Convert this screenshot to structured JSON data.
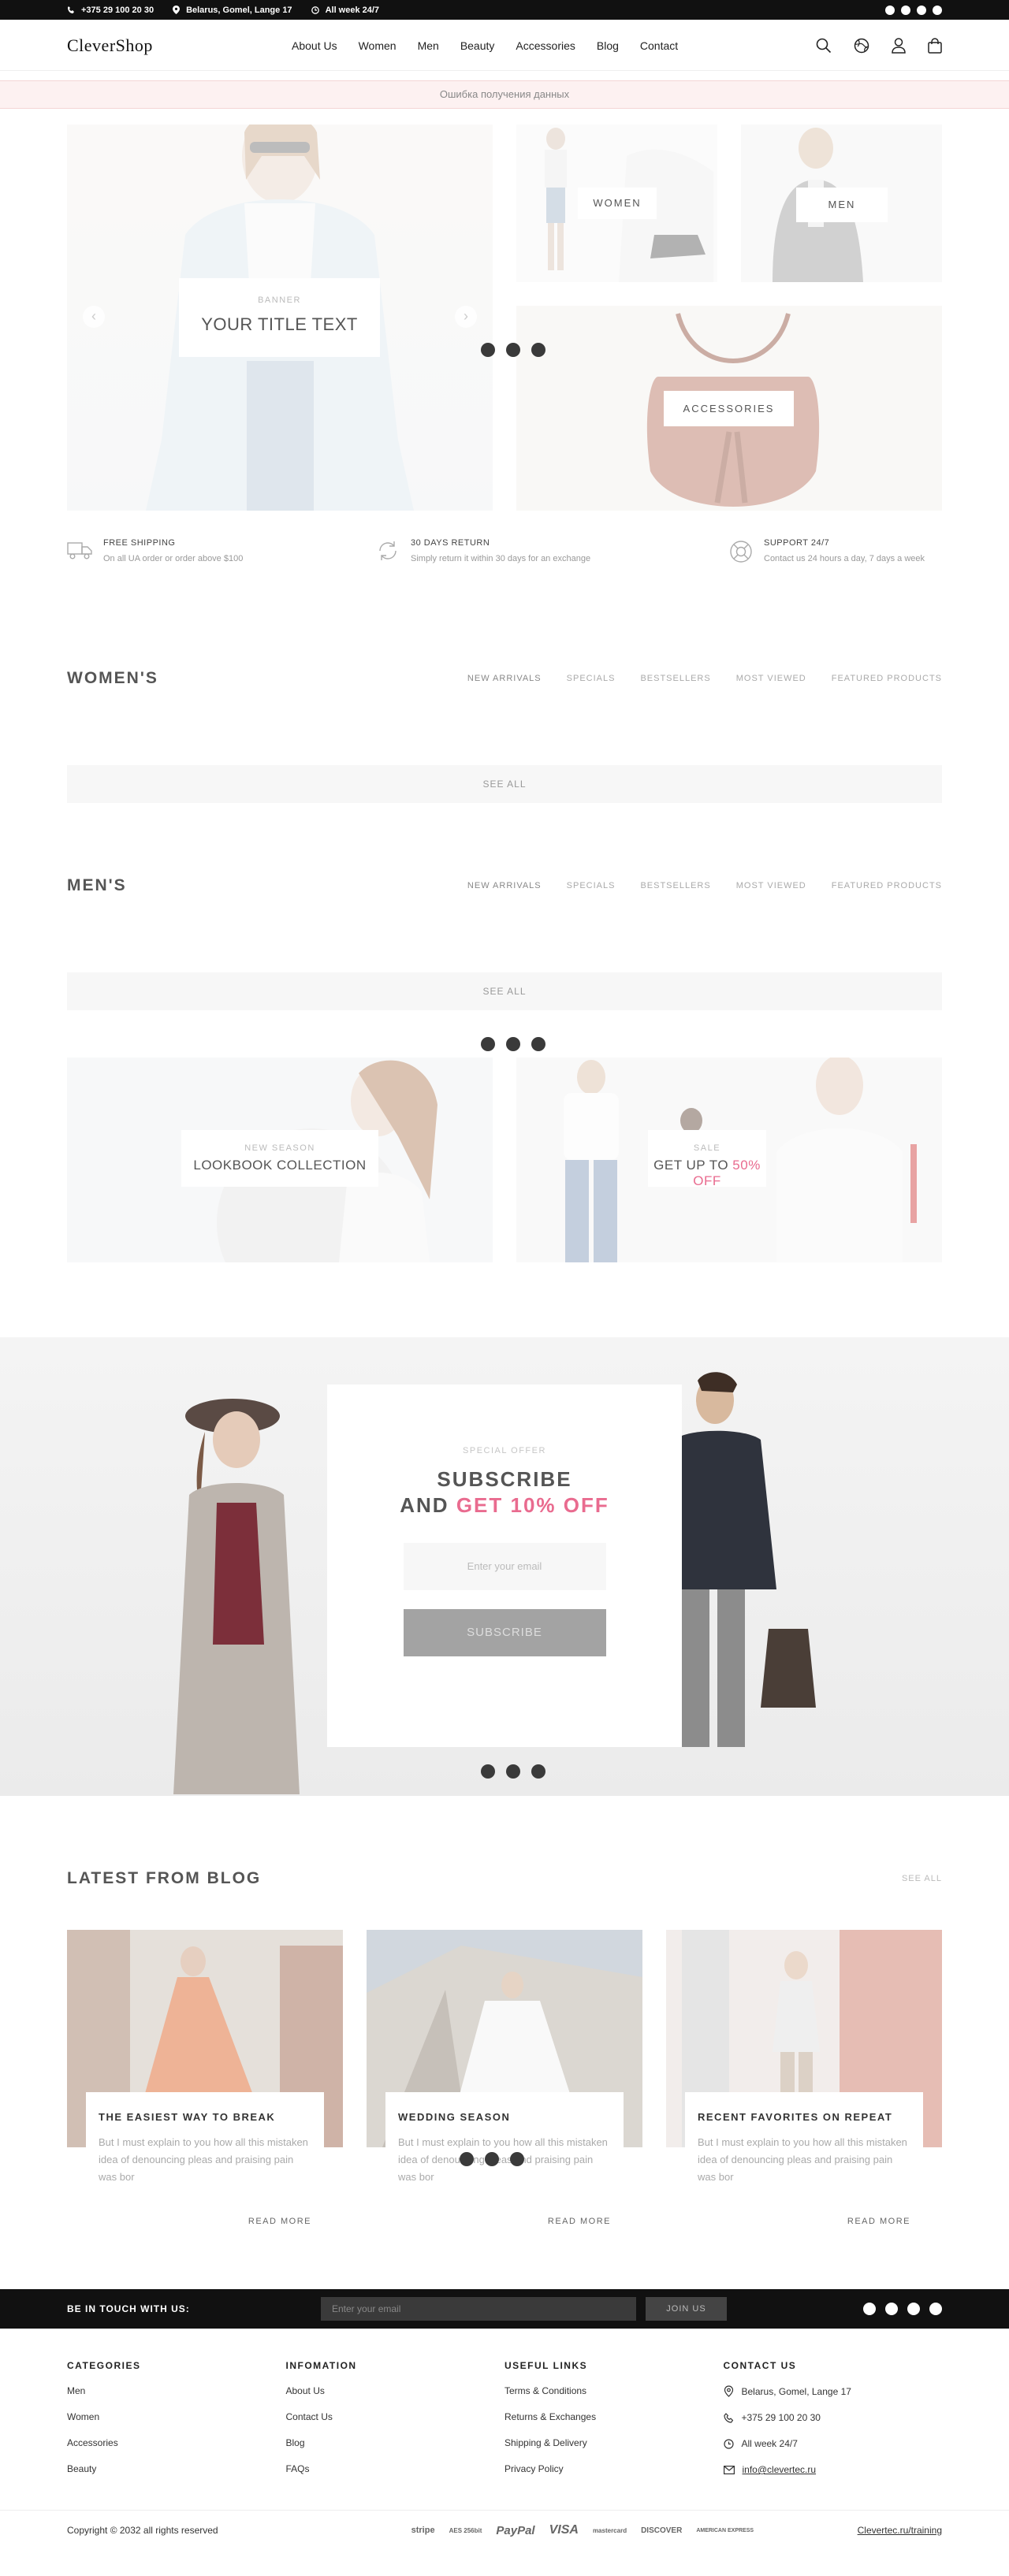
{
  "topbar": {
    "phone": "+375 29 100 20 30",
    "address": "Belarus, Gomel, Lange 17",
    "hours": "All week 24/7"
  },
  "header": {
    "logo": "CleverShop",
    "nav": [
      "About Us",
      "Women",
      "Men",
      "Beauty",
      "Accessories",
      "Blog",
      "Contact"
    ]
  },
  "error_message": "Ошибка получения данных",
  "hero": {
    "banner_small": "BANNER",
    "banner_title": "YOUR TITLE TEXT",
    "women_label": "WOMEN",
    "men_label": "MEN",
    "accessories_label": "ACCESSORIES"
  },
  "features": [
    {
      "title": "FREE SHIPPING",
      "desc": "On all UA order or order above $100"
    },
    {
      "title": "30 DAYS RETURN",
      "desc": "Simply return it within 30 days for an exchange"
    },
    {
      "title": "SUPPORT 24/7",
      "desc": "Contact us 24 hours a day, 7 days a week"
    }
  ],
  "womens": {
    "title": "WOMEN'S",
    "tabs": [
      "NEW ARRIVALS",
      "SPECIALS",
      "BESTSELLERS",
      "MOST VIEWED",
      "FEATURED PRODUCTS"
    ],
    "see_all": "SEE ALL"
  },
  "mens": {
    "title": "MEN'S",
    "tabs": [
      "NEW ARRIVALS",
      "SPECIALS",
      "BESTSELLERS",
      "MOST VIEWED",
      "FEATURED PRODUCTS"
    ],
    "see_all": "SEE ALL"
  },
  "promos": {
    "lookbook_small": "NEW SEASON",
    "lookbook_title": "LOOKBOOK COLLECTION",
    "sale_small": "SALE",
    "sale_title_prefix": "GET UP TO",
    "sale_title_highlight": "50% OFF"
  },
  "subscribe": {
    "small": "SPECIAL OFFER",
    "line1": "SUBSCRIBE",
    "line2_prefix": "AND",
    "line2_highlight": "GET 10% OFF",
    "placeholder": "Enter your email",
    "button": "SUBSCRIBE"
  },
  "blog": {
    "title": "LATEST FROM BLOG",
    "see_all": "SEE ALL",
    "read_more": "READ MORE",
    "posts": [
      {
        "title": "THE EASIEST WAY TO BREAK",
        "desc": "But I must explain to you how all this mistaken idea of denouncing pleas and praising pain was bor"
      },
      {
        "title": "WEDDING SEASON",
        "desc": "But I must explain to you how all this mistaken idea of denouncing pleas and praising pain was bor"
      },
      {
        "title": "RECENT FAVORITES ON REPEAT",
        "desc": "But I must explain to you how all this mistaken idea of denouncing pleas and praising pain was bor"
      }
    ]
  },
  "newsletter": {
    "title": "BE IN TOUCH WITH US:",
    "placeholder": "Enter your email",
    "button": "JOIN US"
  },
  "footer": {
    "categories": {
      "title": "CATEGORIES",
      "items": [
        "Men",
        "Women",
        "Accessories",
        "Beauty"
      ]
    },
    "information": {
      "title": "INFOMATION",
      "items": [
        "About Us",
        "Contact Us",
        "Blog",
        "FAQs"
      ]
    },
    "useful": {
      "title": "USEFUL LINKS",
      "items": [
        "Terms & Conditions",
        "Returns & Exchanges",
        "Shipping & Delivery",
        "Privacy Policy"
      ]
    },
    "contact": {
      "title": "CONTACT US",
      "address": "Belarus, Gomel, Lange 17",
      "phone": "+375 29 100 20 30",
      "hours": "All week 24/7",
      "email": "info@clevertec.ru"
    }
  },
  "bottom": {
    "copyright": "Copyright © 2032 all rights reserved",
    "payments": [
      "stripe",
      "AES 256bit",
      "PayPal",
      "VISA",
      "mastercard",
      "DISCOVER",
      "AMERICAN EXPRESS"
    ],
    "credit": "Clevertec.ru/training"
  }
}
